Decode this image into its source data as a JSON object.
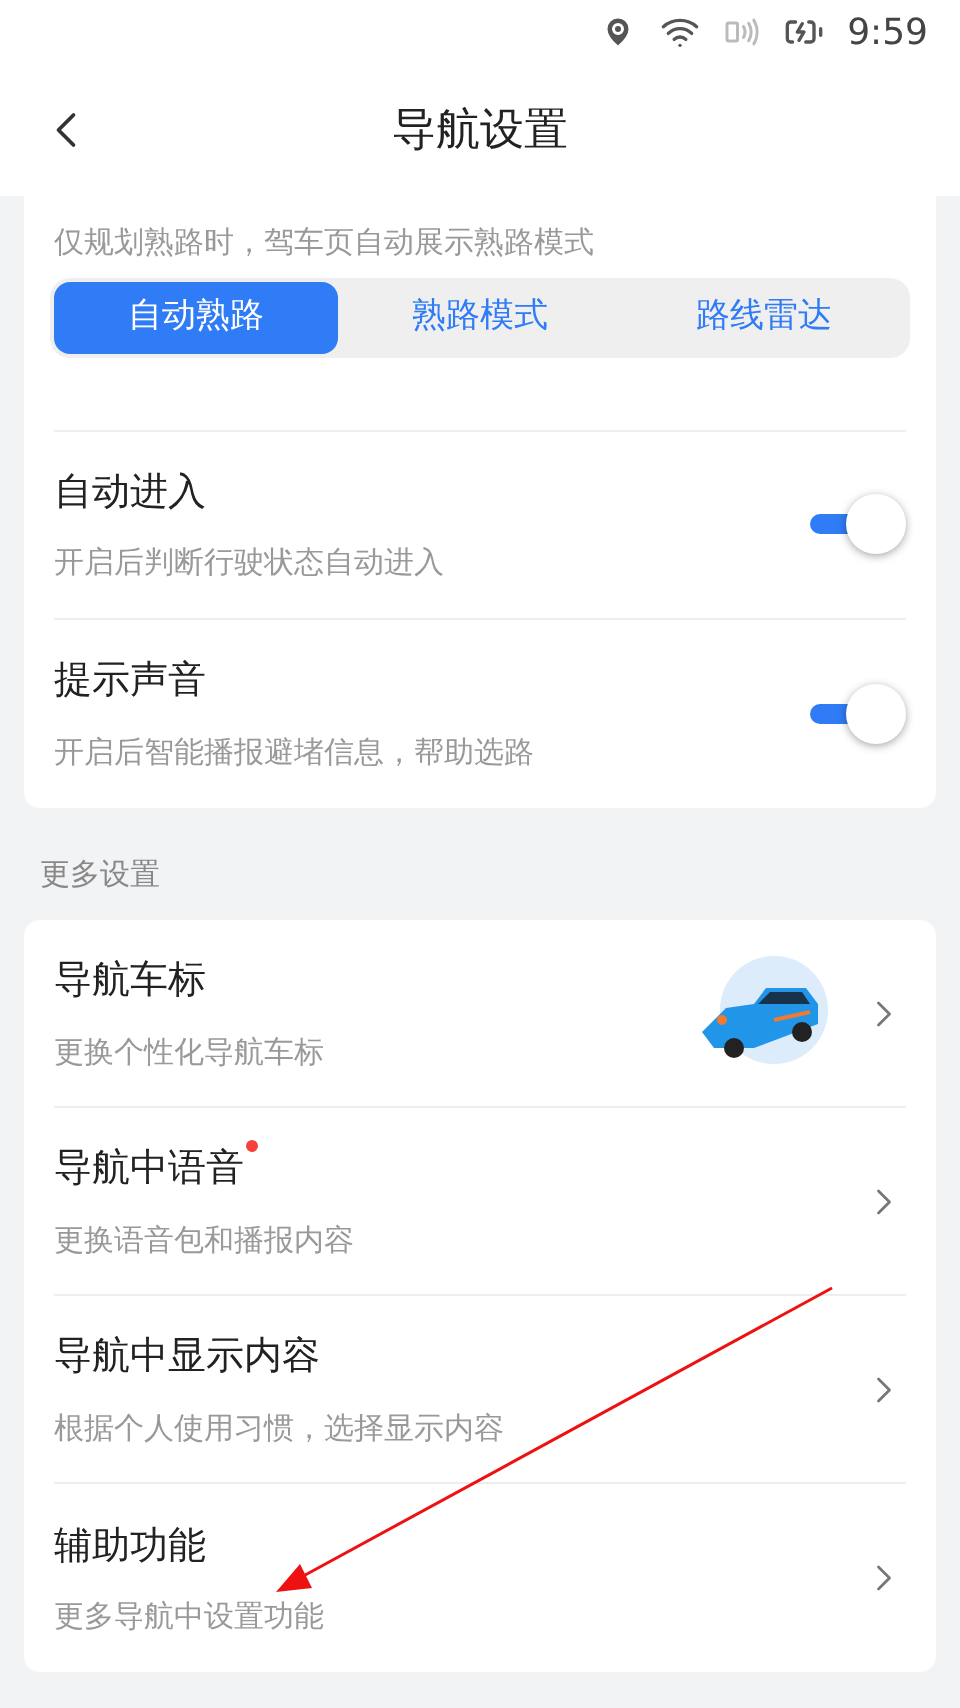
{
  "status_bar": {
    "time": "9:59"
  },
  "header": {
    "title": "导航设置"
  },
  "familiar_route": {
    "description": "仅规划熟路时，驾车页自动展示熟路模式",
    "options": [
      {
        "label": "自动熟路",
        "selected": true
      },
      {
        "label": "熟路模式",
        "selected": false
      },
      {
        "label": "路线雷达",
        "selected": false
      }
    ]
  },
  "toggles": [
    {
      "title": "自动进入",
      "subtitle": "开启后判断行驶状态自动进入",
      "on": true
    },
    {
      "title": "提示声音",
      "subtitle": "开启后智能播报避堵信息，帮助选路",
      "on": true
    }
  ],
  "section_title": "更多设置",
  "more_settings": [
    {
      "title": "导航车标",
      "subtitle": "更换个性化导航车标",
      "kind": "car",
      "new": false
    },
    {
      "title": "导航中语音",
      "subtitle": "更换语音包和播报内容",
      "kind": "plain",
      "new": true
    },
    {
      "title": "导航中显示内容",
      "subtitle": "根据个人使用习惯，选择显示内容",
      "kind": "plain",
      "new": false
    },
    {
      "title": "辅助功能",
      "subtitle": "更多导航中设置功能",
      "kind": "plain",
      "new": false
    }
  ]
}
